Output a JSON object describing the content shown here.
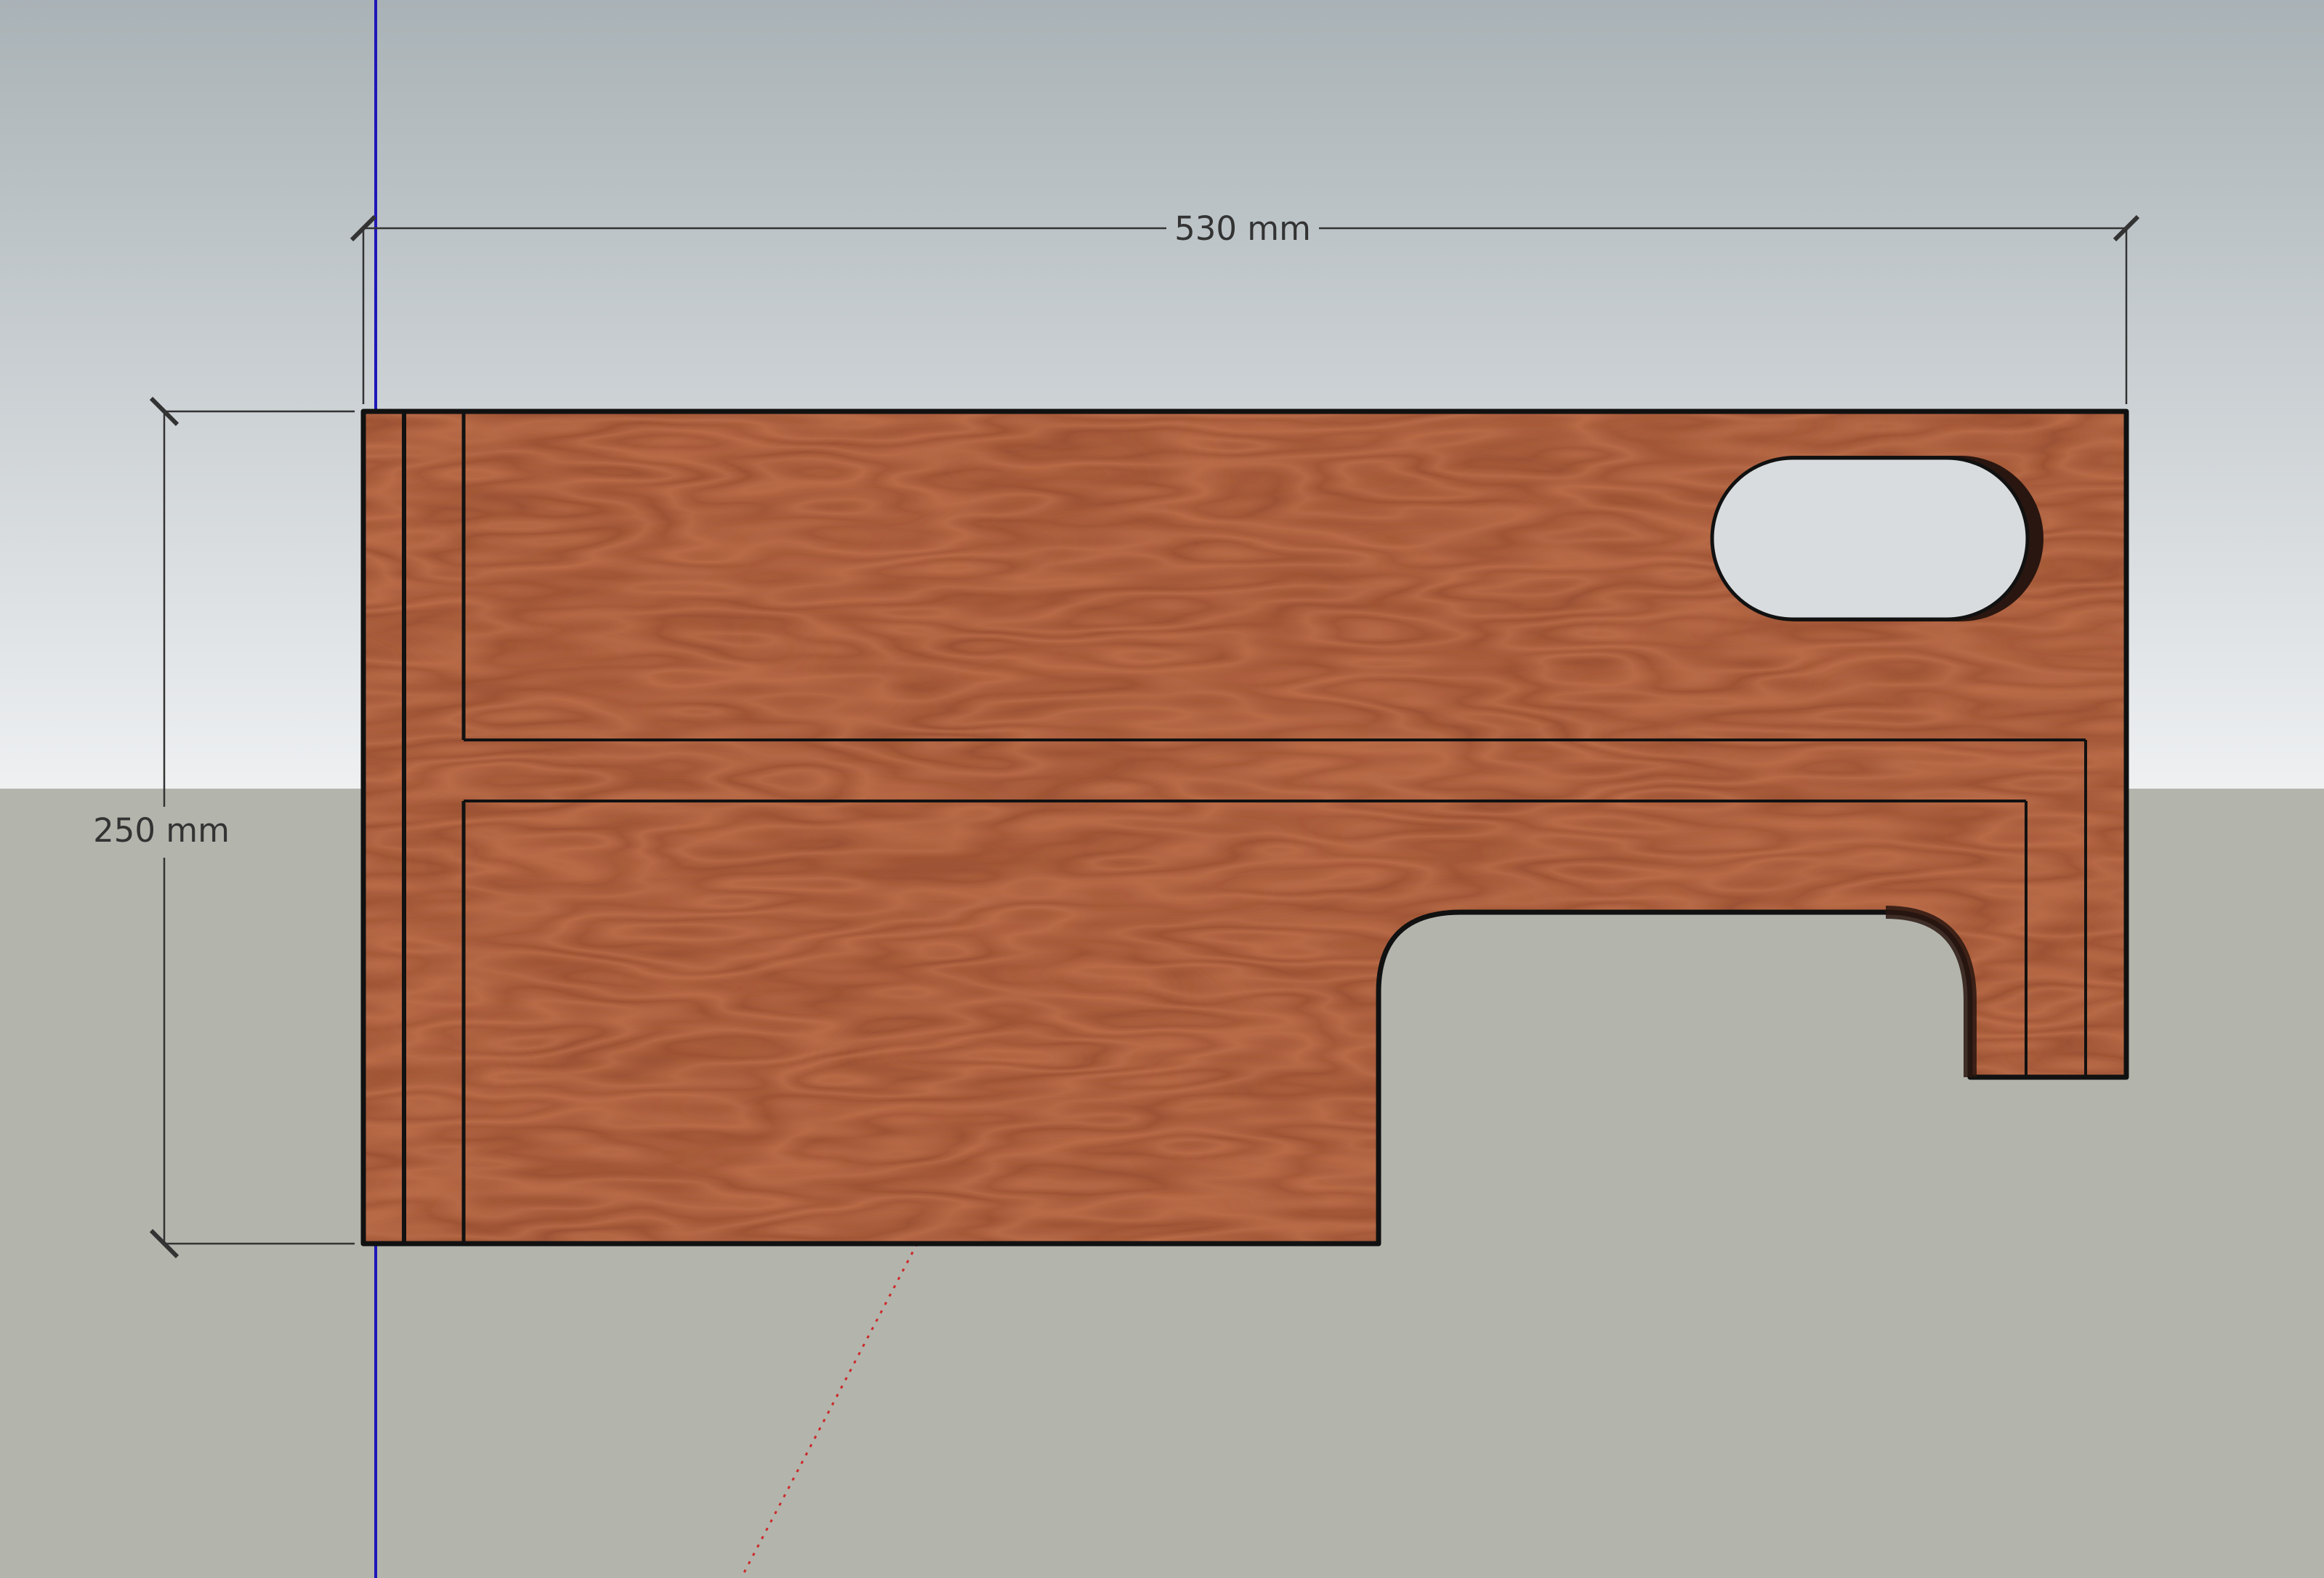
{
  "viewport": {
    "sky_top_color": "#a9b2b6",
    "sky_horizon_color": "#eef0f2",
    "ground_color": "#b3b5ad",
    "wood_base_color": "#b1603f",
    "wood_dark_color": "#8e4526",
    "wood_light_color": "#d27f56",
    "edge_color": "#111111",
    "blue_axis_color": "#1e16b8",
    "red_axis_color": "#cc2a2a"
  },
  "dimensions": {
    "width_label": "530 mm",
    "height_label": "250 mm"
  }
}
